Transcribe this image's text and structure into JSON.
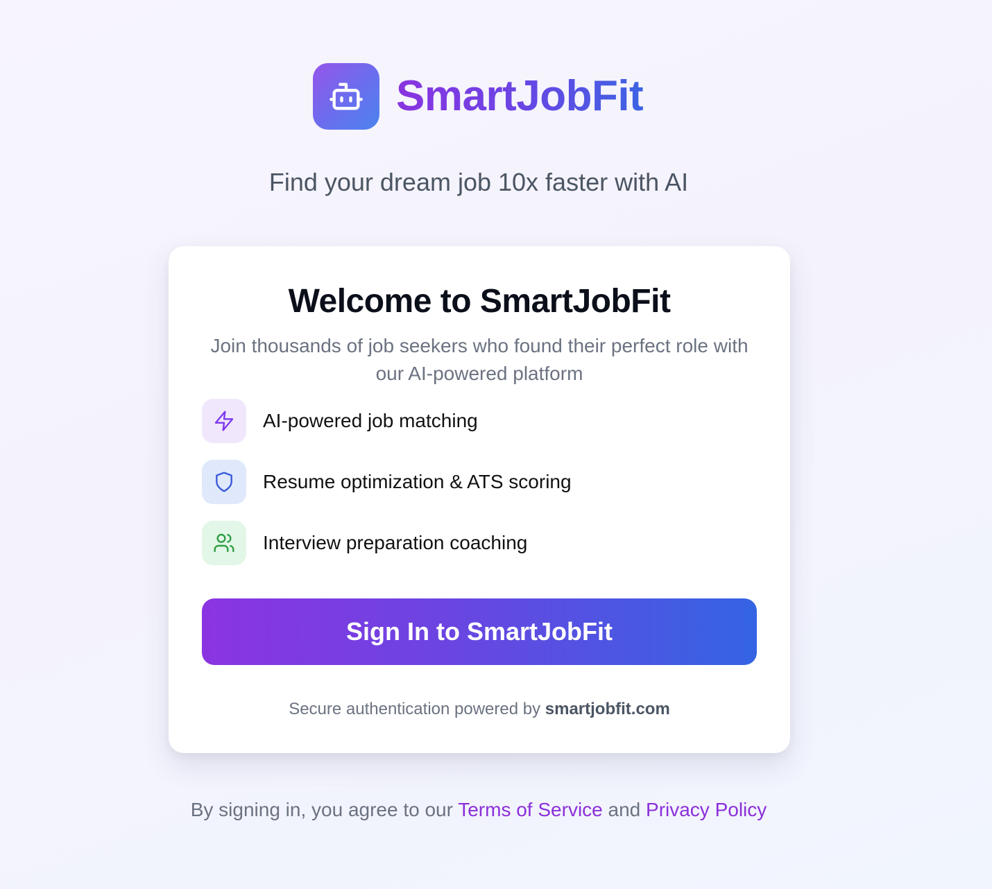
{
  "brand": {
    "name": "SmartJobFit",
    "logo_icon": "bot-icon",
    "gradient_start": "#8a34e0",
    "gradient_end": "#3d63e3"
  },
  "tagline": "Find your dream job 10x faster with AI",
  "card": {
    "title": "Welcome to SmartJobFit",
    "subtitle": "Join thousands of job seekers who found their perfect role with our AI-powered platform",
    "features": [
      {
        "label": "AI-powered job matching",
        "icon": "zap-icon",
        "color": "#7c3aed"
      },
      {
        "label": "Resume optimization & ATS scoring",
        "icon": "shield-icon",
        "color": "#3b5bdb"
      },
      {
        "label": "Interview preparation coaching",
        "icon": "users-icon",
        "color": "#2f9e44"
      }
    ],
    "signin_button": "Sign In to SmartJobFit",
    "secure_prefix": "Secure authentication powered by",
    "secure_domain": "smartjobfit.com"
  },
  "legal": {
    "prefix": "By signing in, you agree to our",
    "terms": "Terms of Service",
    "and": "and",
    "privacy": "Privacy Policy",
    "link_color": "#8b2fd9"
  }
}
